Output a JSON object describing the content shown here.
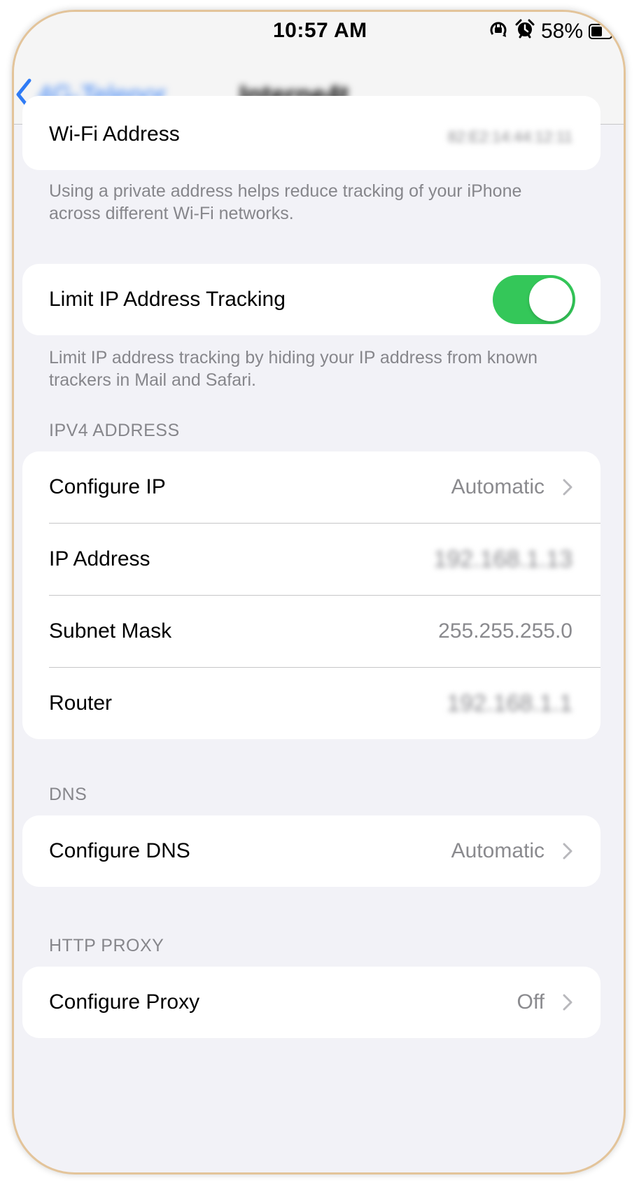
{
  "status_bar": {
    "time": "10:57 AM",
    "battery_percent": "58%",
    "battery_level": 0.58,
    "icons": [
      "orientation-lock-icon",
      "alarm-icon",
      "battery-icon"
    ]
  },
  "nav": {
    "back_label": "4G-Telenor",
    "title": "Interne4t"
  },
  "wifi_address": {
    "label": "Wi-Fi Address",
    "value": "82:E2:14:44:12:11",
    "footnote": "Using a private address helps reduce tracking of your iPhone across different Wi-Fi networks."
  },
  "limit_ip": {
    "label": "Limit IP Address Tracking",
    "enabled": true,
    "footnote": "Limit IP address tracking by hiding your IP address from known trackers in Mail and Safari."
  },
  "ipv4": {
    "header": "IPV4 ADDRESS",
    "configure_ip": {
      "label": "Configure IP",
      "value": "Automatic"
    },
    "ip_address": {
      "label": "IP Address",
      "value": "192.168.1.13"
    },
    "subnet_mask": {
      "label": "Subnet Mask",
      "value": "255.255.255.0"
    },
    "router": {
      "label": "Router",
      "value": "192.168.1.1"
    }
  },
  "dns": {
    "header": "DNS",
    "configure_dns": {
      "label": "Configure DNS",
      "value": "Automatic"
    }
  },
  "http_proxy": {
    "header": "HTTP PROXY",
    "configure_proxy": {
      "label": "Configure Proxy",
      "value": "Off"
    }
  },
  "colors": {
    "accent": "#2f7bf5",
    "toggle_on": "#34c759",
    "background": "#f2f2f7",
    "frame": "#e3c49a"
  }
}
